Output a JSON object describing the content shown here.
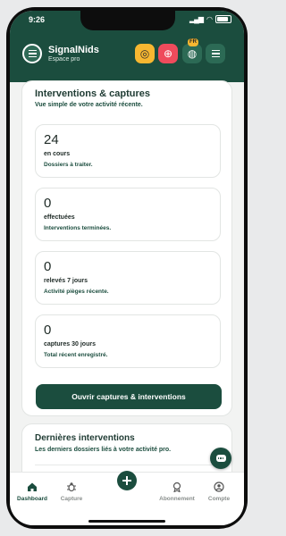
{
  "status": {
    "time": "9:26",
    "battery": "100"
  },
  "header": {
    "app_name": "SignalNids",
    "app_subtitle": "Espace pro",
    "lang_badge": "FR",
    "icons": [
      "target-icon",
      "gps-icon",
      "globe-icon",
      "menu-icon"
    ],
    "colors": {
      "primary": "#1b4d3e",
      "yellow": "#f7b731",
      "red": "#ef4b5c"
    }
  },
  "panel": {
    "title": "Interventions & captures",
    "subtitle": "Vue simple de votre activité récente.",
    "cards": [
      {
        "value": "24",
        "label": "en cours",
        "desc": "Dossiers à traiter."
      },
      {
        "value": "0",
        "label": "effectuées",
        "desc": "Interventions terminées."
      },
      {
        "value": "0",
        "label": "relevés 7 jours",
        "desc": "Activité pièges récente."
      },
      {
        "value": "0",
        "label": "captures 30 jours",
        "desc": "Total récent enregistré."
      }
    ],
    "cta_label": "Ouvrir captures & interventions"
  },
  "panel2": {
    "title": "Dernières interventions",
    "subtitle": "Les derniers dossiers liés à votre activité pro."
  },
  "nav": {
    "items": [
      {
        "label": "Dashboard",
        "icon": "home-icon",
        "active": true
      },
      {
        "label": "Capture",
        "icon": "bug-icon",
        "active": false
      },
      {
        "label": "",
        "icon": "plus-icon",
        "active": false
      },
      {
        "label": "Abonnement",
        "icon": "badge-icon",
        "active": false
      },
      {
        "label": "Compte",
        "icon": "user-icon",
        "active": false
      }
    ]
  }
}
